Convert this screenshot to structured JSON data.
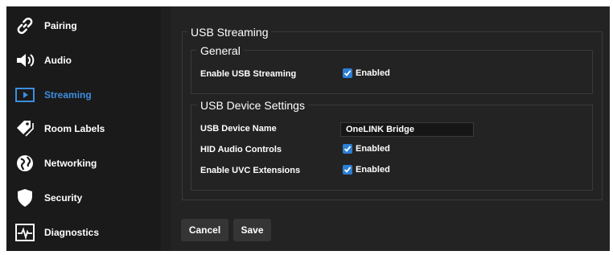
{
  "sidebar": {
    "items": [
      {
        "label": "Pairing",
        "icon": "link-icon"
      },
      {
        "label": "Audio",
        "icon": "speaker-icon"
      },
      {
        "label": "Streaming",
        "icon": "play-icon",
        "active": true
      },
      {
        "label": "Room Labels",
        "icon": "tag-icon"
      },
      {
        "label": "Networking",
        "icon": "globe-icon"
      },
      {
        "label": "Security",
        "icon": "shield-icon"
      },
      {
        "label": "Diagnostics",
        "icon": "pulse-icon"
      }
    ]
  },
  "main": {
    "section_title": "USB Streaming",
    "general": {
      "title": "General",
      "enable_usb_label": "Enable USB Streaming",
      "enable_usb_value": "Enabled"
    },
    "device": {
      "title": "USB Device Settings",
      "name_label": "USB Device Name",
      "name_value": "OneLINK Bridge",
      "hid_label": "HID Audio Controls",
      "hid_value": "Enabled",
      "uvc_label": "Enable UVC Extensions",
      "uvc_value": "Enabled"
    },
    "buttons": {
      "cancel": "Cancel",
      "save": "Save"
    }
  },
  "colors": {
    "accent": "#3d8ee0",
    "sidebar_bg": "#1a1a1a",
    "panel_bg": "#232323",
    "checkbox": "#2b7fd4"
  }
}
